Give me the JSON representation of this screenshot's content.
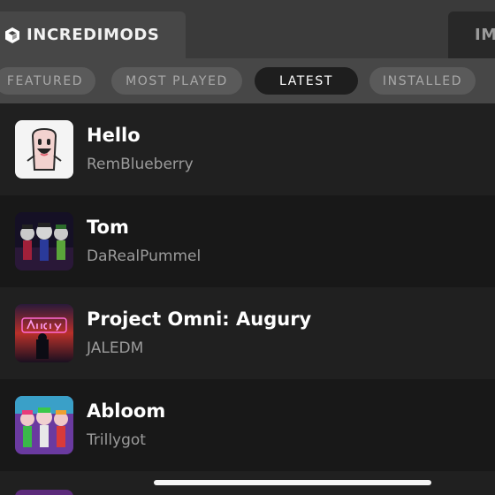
{
  "tabs": [
    {
      "label": "INCREDIMODS",
      "icon": "cube-icon"
    },
    {
      "label": "IM"
    }
  ],
  "filters": [
    {
      "label": "FEATURED",
      "active": false
    },
    {
      "label": "MOST PLAYED",
      "active": false
    },
    {
      "label": "LATEST",
      "active": true
    },
    {
      "label": "INSTALLED",
      "active": false
    }
  ],
  "mods": [
    {
      "title": "Hello",
      "author": "RemBlueberry",
      "thumbnail": "toast-character-thumbnail"
    },
    {
      "title": "Tom",
      "author": "DaRealPummel",
      "thumbnail": "band-characters-thumbnail"
    },
    {
      "title": "Project Omni: Augury",
      "author": "JALEDM",
      "thumbnail": "augury-neon-sign-thumbnail"
    },
    {
      "title": "Abloom",
      "author": "Trillygot",
      "thumbnail": "colorful-band-thumbnail"
    }
  ],
  "colors": {
    "topbar": "#3a3a3a",
    "active_tab": "#474747",
    "pill_inactive": "#5a5a5a",
    "pill_active": "#1e1e1e",
    "row_odd": "#202020",
    "row_even": "#181818",
    "author_text": "#9b9b9b"
  }
}
